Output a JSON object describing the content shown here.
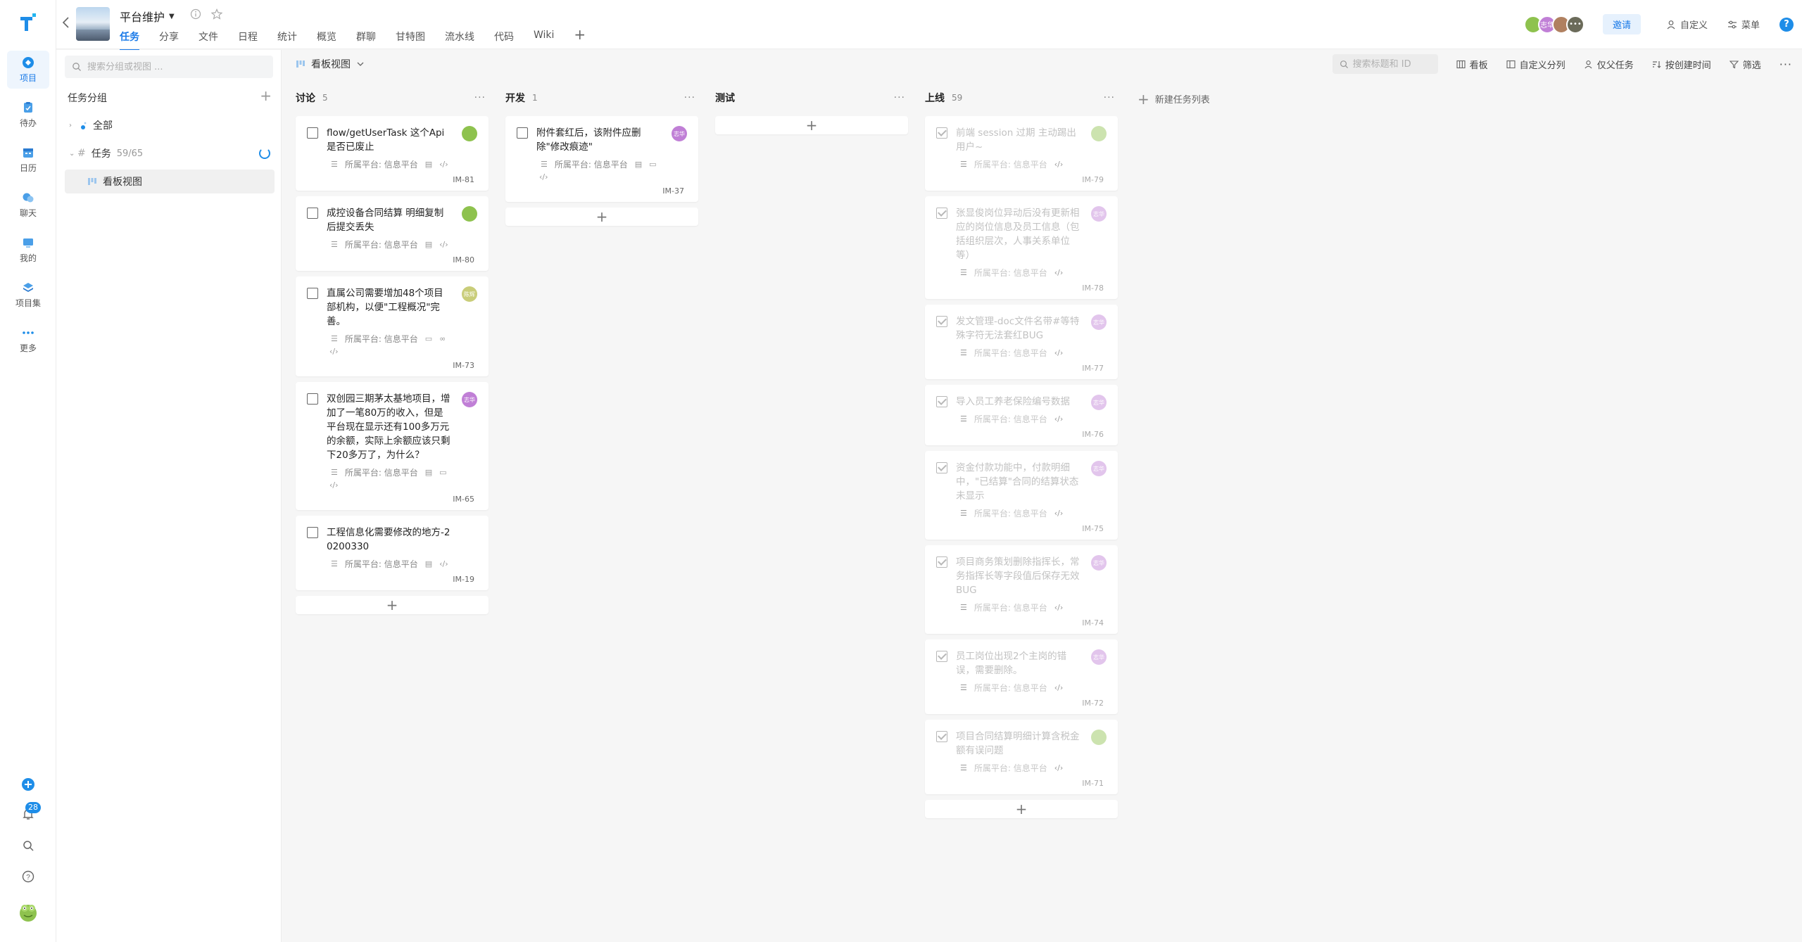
{
  "rail": {
    "items": [
      {
        "label": "项目",
        "icon": "project-icon"
      },
      {
        "label": "待办",
        "icon": "todo-icon"
      },
      {
        "label": "日历",
        "icon": "calendar-icon"
      },
      {
        "label": "聊天",
        "icon": "chat-icon"
      },
      {
        "label": "我的",
        "icon": "monitor-icon"
      },
      {
        "label": "项目集",
        "icon": "layers-icon"
      },
      {
        "label": "更多",
        "icon": "more-icon"
      }
    ],
    "notification_count": "28"
  },
  "header": {
    "project_title": "平台维护",
    "tabs": [
      "任务",
      "分享",
      "文件",
      "日程",
      "统计",
      "概览",
      "群聊",
      "甘特图",
      "流水线",
      "代码",
      "Wiki"
    ],
    "invite_label": "邀请",
    "customize_label": "自定义",
    "menu_label": "菜单",
    "avatar_labels": [
      "",
      "志华",
      "",
      "•••"
    ]
  },
  "side": {
    "search_placeholder": "搜索分组或视图 ...",
    "section_title": "任务分组",
    "all_label": "全部",
    "tasks_label": "任务",
    "tasks_count": "59/65",
    "view_label": "看板视图"
  },
  "toolbar": {
    "view_name": "看板视图",
    "search_placeholder": "搜索标题和 ID",
    "board_label": "看板",
    "custom_columns_label": "自定义分列",
    "parent_only_label": "仅父任务",
    "sort_label": "按创建时间",
    "filter_label": "筛选"
  },
  "board": {
    "new_list_label": "新建任务列表",
    "meta_text": "所属平台: 信息平台",
    "columns": [
      {
        "name": "讨论",
        "count": "5",
        "cards": [
          {
            "title": "flow/getUserTask 这个Api是否已废止",
            "id": "IM-81",
            "avatar": "",
            "color": "#8ec24e"
          },
          {
            "title": "成控设备合同结算 明细复制后提交丢失",
            "id": "IM-80",
            "avatar": "",
            "color": "#8ec24e"
          },
          {
            "title": "直属公司需要增加48个项目部机构，以便\"工程概况\"完善。",
            "id": "IM-73",
            "avatar": "陈辉",
            "color": "#c9cd79"
          },
          {
            "title": "双创园三期茅太基地项目，增加了一笔80万的收入，但是平台现在显示还有100多万元的余额，实际上余额应该只剩下20多万了，为什么？",
            "id": "IM-65",
            "avatar": "志华",
            "color": "#c07fd6"
          },
          {
            "title": "工程信息化需要修改的地方-20200330",
            "id": "IM-19",
            "avatar": "",
            "color": ""
          }
        ]
      },
      {
        "name": "开发",
        "count": "1",
        "cards": [
          {
            "title": "附件套红后，该附件应删除\"修改痕迹\"",
            "id": "IM-37",
            "avatar": "志华",
            "color": "#c07fd6"
          }
        ]
      },
      {
        "name": "测试",
        "count": "",
        "cards": []
      },
      {
        "name": "上线",
        "count": "59",
        "cards": [
          {
            "title": "前端 session 过期 主动踢出用户~",
            "id": "IM-79",
            "avatar": "",
            "color": "#8ec24e"
          },
          {
            "title": "张显俊岗位异动后没有更新相应的岗位信息及员工信息（包括组织层次，人事关系单位等）",
            "id": "IM-78",
            "avatar": "志华",
            "color": "#c07fd6"
          },
          {
            "title": "发文管理-doc文件名带#等特殊字符无法套红BUG",
            "id": "IM-77",
            "avatar": "志华",
            "color": "#c07fd6"
          },
          {
            "title": "导入员工养老保险编号数据",
            "id": "IM-76",
            "avatar": "志华",
            "color": "#c07fd6"
          },
          {
            "title": "资金付款功能中，付款明细中，\"已结算\"合同的结算状态未显示",
            "id": "IM-75",
            "avatar": "志华",
            "color": "#c07fd6"
          },
          {
            "title": "项目商务策划删除指挥长，常务指挥长等字段值后保存无效BUG",
            "id": "IM-74",
            "avatar": "志华",
            "color": "#c07fd6"
          },
          {
            "title": "员工岗位出现2个主岗的错误，需要删除。",
            "id": "IM-72",
            "avatar": "志华",
            "color": "#c07fd6"
          },
          {
            "title": "项目合同结算明细计算含税金额有误问题",
            "id": "IM-71",
            "avatar": "",
            "color": "#8ec24e"
          }
        ]
      }
    ]
  }
}
